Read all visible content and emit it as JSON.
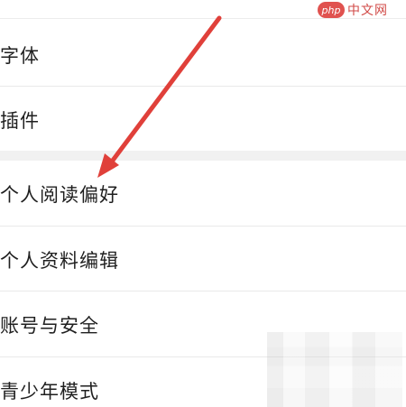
{
  "watermark": {
    "badge": "php",
    "text": "中文网"
  },
  "settings": {
    "items": [
      {
        "label": "字体"
      },
      {
        "label": "插件"
      },
      {
        "label": "个人阅读偏好"
      },
      {
        "label": "个人资料编辑"
      },
      {
        "label": "账号与安全"
      },
      {
        "label": "青少年模式"
      }
    ]
  },
  "colors": {
    "arrow": "#e0403a",
    "text": "#1f1f1f",
    "divider": "#e9e9e9",
    "section_gap": "#f1f1f1"
  }
}
